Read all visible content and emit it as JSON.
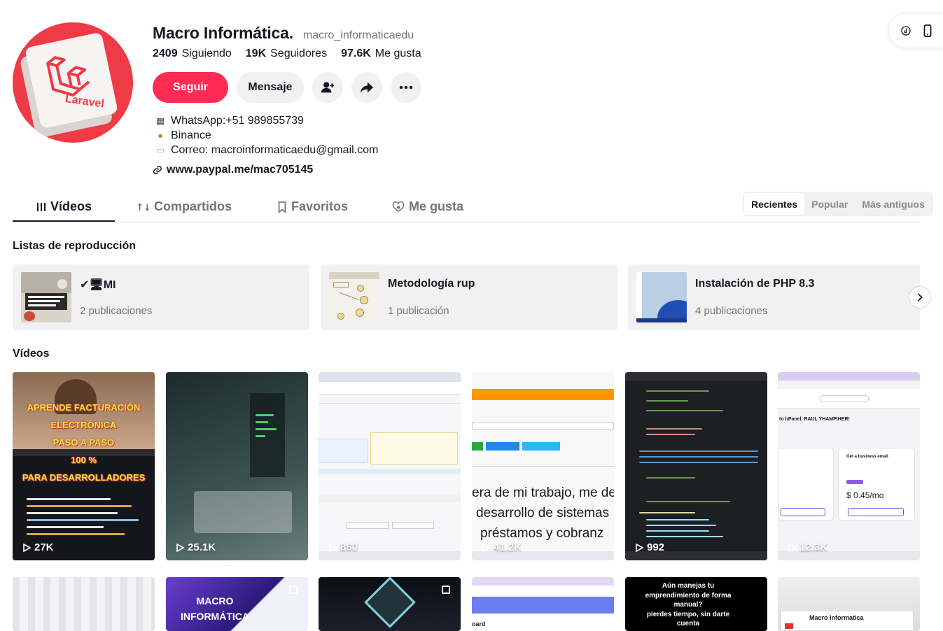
{
  "profile": {
    "display_name": "Macro Informática.",
    "handle": "macro_informaticaedu",
    "avatar_text": "Laravel",
    "stats": [
      {
        "value": "2409",
        "label": "Siguiendo"
      },
      {
        "value": "19K",
        "label": "Seguidores"
      },
      {
        "value": "97.6K",
        "label": "Me gusta"
      }
    ],
    "bio": [
      {
        "icon": "calculator-icon",
        "glyph": "▦",
        "text": "WhatsApp:+51 989855739"
      },
      {
        "icon": "money-bag-icon",
        "glyph": "●",
        "text": "Binance"
      },
      {
        "icon": "envelope-icon",
        "glyph": "▭",
        "text": "Correo: macroinformaticaedu@gmail.com"
      }
    ],
    "link": "www.paypal.me/mac705145"
  },
  "actions": {
    "follow": "Seguir",
    "message": "Mensaje"
  },
  "tabs": [
    {
      "label": "Vídeos",
      "active": true
    },
    {
      "label": "Compartidos",
      "active": false
    },
    {
      "label": "Favoritos",
      "active": false
    },
    {
      "label": "Me gusta",
      "active": false
    }
  ],
  "sort": [
    {
      "label": "Recientes",
      "active": true
    },
    {
      "label": "Popular",
      "active": false
    },
    {
      "label": "Más antiguos",
      "active": false
    }
  ],
  "playlists_section": {
    "title": "Listas de reproducción",
    "items": [
      {
        "title": "✔🖥MI",
        "count": "2 publicaciones"
      },
      {
        "title": "Metodología rup",
        "count": "1 publicación"
      },
      {
        "title": "Instalación de PHP 8.3",
        "count": "4 publicaciones"
      }
    ]
  },
  "videos_section": {
    "title": "Vídeos",
    "items": [
      {
        "views": "27K",
        "overlay": [
          "APRENDE FACTURACIÓN",
          "ELECTRÓNICA",
          "PASO A PASO",
          "100 %",
          "PARA DESARROLLADORES"
        ]
      },
      {
        "views": "25.1K"
      },
      {
        "views": "850"
      },
      {
        "views": "41.2K",
        "overlay": [
          "era de mi trabajo, me de",
          "desarrollo de sistemas",
          "préstamos y cobranz"
        ]
      },
      {
        "views": "992"
      },
      {
        "views": "12.3K",
        "overlay": [
          "to hPanel, RAUL YHAMPIHER!",
          "Get a business email",
          "$ 0.45/mo"
        ]
      }
    ],
    "row2": [
      {
        "overlay": []
      },
      {
        "overlay": [
          "MACRO",
          "INFORMÁTICA"
        ]
      },
      {
        "overlay": []
      },
      {
        "overlay": [
          "oard"
        ]
      },
      {
        "overlay": [
          "Aún manejas tu",
          "emprendimiento de forma",
          "manual?",
          "pierdes tiempo, sin darte",
          "cuenta"
        ]
      },
      {
        "overlay": [
          "Macro Informatica"
        ]
      }
    ]
  }
}
